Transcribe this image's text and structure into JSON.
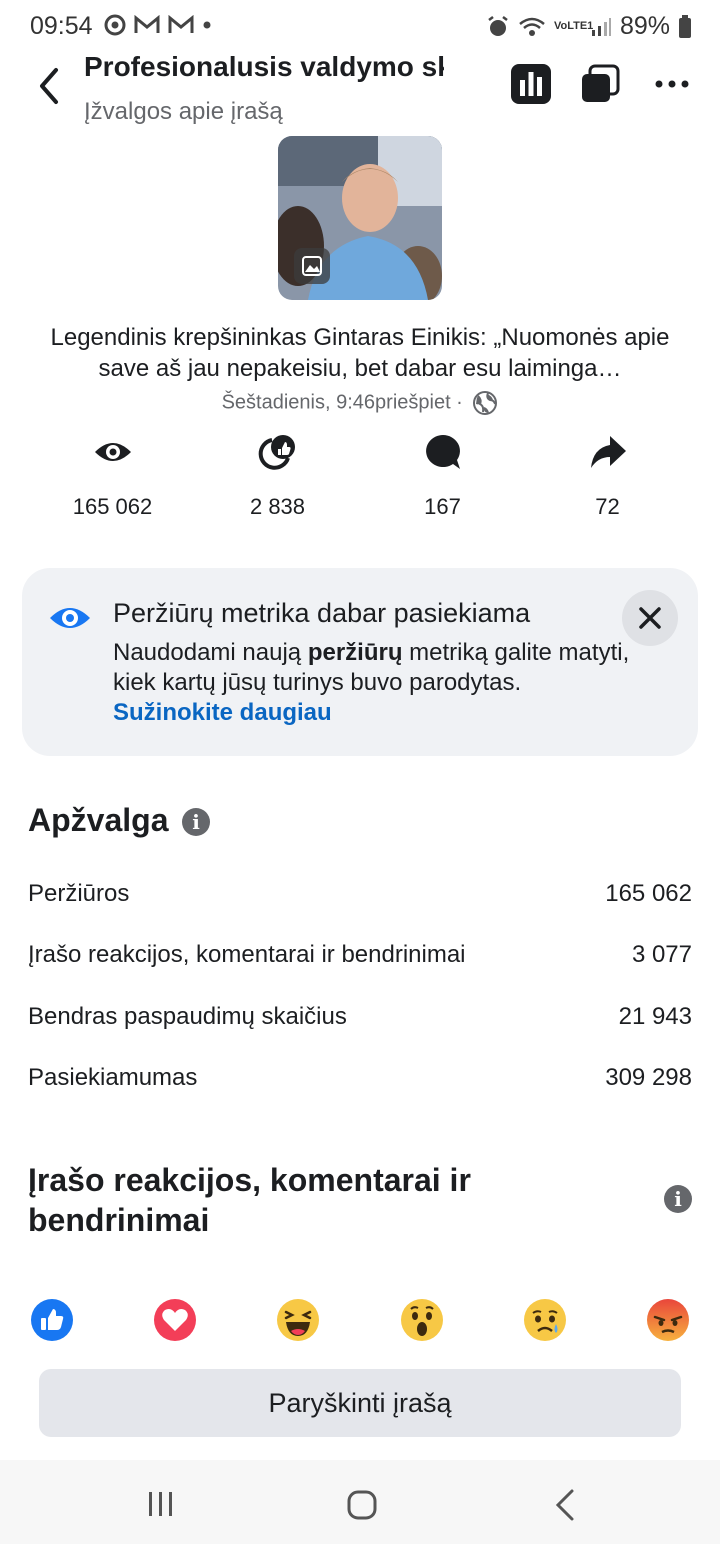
{
  "status_bar": {
    "time": "09:54",
    "battery": "89%",
    "network_label": "VoLTE1"
  },
  "header": {
    "title": "Profesionalusis valdymo skydelis",
    "subtitle": "Įžvalgos apie įrašą"
  },
  "post": {
    "text": "Legendinis krepšininkas Gintaras Einikis: „Nuomonės apie save aš jau nepakeisiu, bet dabar esu laiminga…",
    "meta": "Šeštadienis, 9:46priešpiet ·"
  },
  "quick_stats": [
    {
      "icon": "eye-icon",
      "value": "165 062"
    },
    {
      "icon": "reactions-icon",
      "value": "2 838"
    },
    {
      "icon": "comment-icon",
      "value": "167"
    },
    {
      "icon": "share-icon",
      "value": "72"
    }
  ],
  "notice": {
    "title": "Peržiūrų metrika dabar pasiekiama",
    "body_1": "Naudodami naują ",
    "body_bold": "peržiūrų",
    "body_2": " metriką galite matyti, kiek kartų jūsų turinys buvo parodytas. ",
    "link": "Sužinokite daugiau"
  },
  "overview": {
    "title": "Apžvalga",
    "rows": [
      {
        "label": "Peržiūros",
        "value": "165 062"
      },
      {
        "label": "Įrašo reakcijos, komentarai ir bendrinimai",
        "value": "3 077"
      },
      {
        "label": "Bendras paspaudimų skaičius",
        "value": "21 943"
      },
      {
        "label": "Pasiekiamumas",
        "value": "309 298"
      }
    ]
  },
  "engagement": {
    "title_line1": "Įrašo reakcijos, komentarai ir",
    "title_line2": "bendrinimai",
    "reactions": [
      "like-icon",
      "love-icon",
      "haha-icon",
      "wow-icon",
      "sad-icon",
      "angry-icon"
    ]
  },
  "boost_button": "Paryškinti įrašą",
  "colors": {
    "facebook_blue": "#1877f2",
    "link_blue": "#0a66c2",
    "love_red": "#f33e58",
    "angry_orange": "#e9710f",
    "emoji_yellow": "#f7c845"
  }
}
